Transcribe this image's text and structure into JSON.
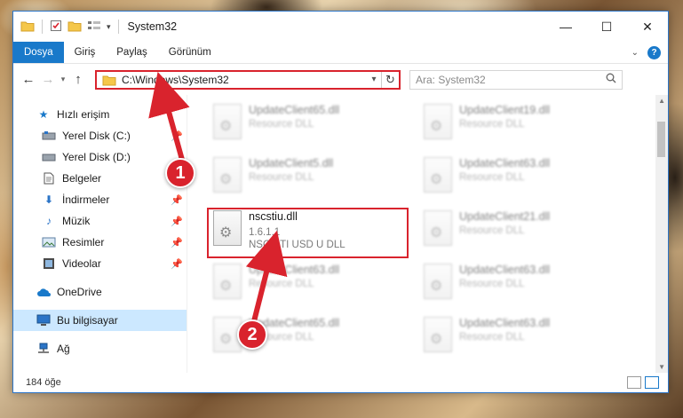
{
  "window": {
    "title": "System32",
    "controls": {
      "minimize": "—",
      "maximize": "☐",
      "close": "✕"
    }
  },
  "ribbon": {
    "tabs": [
      {
        "label": "Dosya",
        "active": true
      },
      {
        "label": "Giriş"
      },
      {
        "label": "Paylaş"
      },
      {
        "label": "Görünüm"
      }
    ]
  },
  "address": {
    "path": "C:\\Windows\\System32",
    "search_placeholder": "Ara: System32"
  },
  "nav": {
    "quick_access": "Hızlı erişim",
    "items": [
      {
        "label": "Yerel Disk (C:)",
        "icon": "drive-icon",
        "pinned": true
      },
      {
        "label": "Yerel Disk (D:)",
        "icon": "drive-icon",
        "pinned": false
      },
      {
        "label": "Belgeler",
        "icon": "documents-icon",
        "pinned": true
      },
      {
        "label": "İndirmeler",
        "icon": "download-icon",
        "pinned": true
      },
      {
        "label": "Müzik",
        "icon": "music-icon",
        "pinned": true
      },
      {
        "label": "Resimler",
        "icon": "pictures-icon",
        "pinned": true
      },
      {
        "label": "Videolar",
        "icon": "videos-icon",
        "pinned": true
      }
    ],
    "onedrive": "OneDrive",
    "this_pc": "Bu bilgisayar",
    "network": "Ağ"
  },
  "files": [
    {
      "name": "UpdateClient65.dll",
      "type": "Resource DLL"
    },
    {
      "name": "UpdateClient19.dll",
      "type": "Resource DLL"
    },
    {
      "name": "UpdateClient5.dll",
      "type": "Resource DLL"
    },
    {
      "name": "UpdateClient63.dll",
      "type": "Resource DLL"
    },
    {
      "name": "nscstiu.dll",
      "version": "1.6.1.1",
      "type": "NSC STI USD U DLL"
    },
    {
      "name": "UpdateClient21.dll",
      "type": "Resource DLL"
    },
    {
      "name": "UpdateClient63.dll",
      "type": "Resource DLL"
    },
    {
      "name": "UpdateClient63.dll",
      "type": "Resource DLL"
    },
    {
      "name": "UpdateClient65.dll",
      "type": "Resource DLL"
    },
    {
      "name": "UpdateClient63.dll",
      "type": "Resource DLL"
    }
  ],
  "status": {
    "count": "184 öğe"
  },
  "callouts": {
    "one": "1",
    "two": "2"
  },
  "colors": {
    "accent": "#1979ca",
    "highlight": "#d9232d",
    "selection": "#cce8ff"
  }
}
